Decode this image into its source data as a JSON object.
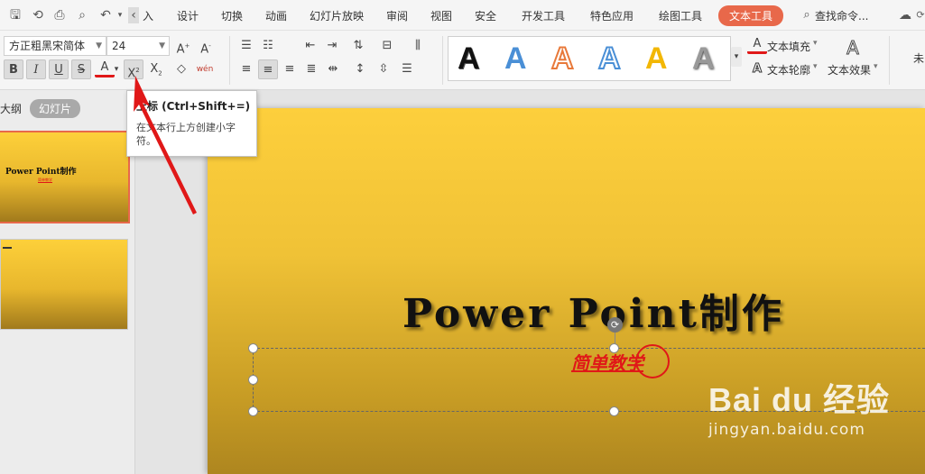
{
  "menubar": {
    "items": [
      "入",
      "设计",
      "切换",
      "动画",
      "幻灯片放映",
      "审阅",
      "视图",
      "安全",
      "开发工具",
      "特色应用",
      "绘图工具",
      "文本工具"
    ],
    "active_index": 11,
    "search_label": "查找命令..."
  },
  "ribbon": {
    "font_name": "方正粗黑宋简体",
    "font_size": "24",
    "wordart_samples": [
      "A",
      "A",
      "A",
      "A",
      "A",
      "A"
    ],
    "text_fill_label": "文本填充",
    "text_outline_label": "文本轮廓",
    "text_effect_label": "文本效果",
    "more_label": "未"
  },
  "left_pane": {
    "tab_outline": "大纲",
    "tab_slides": "幻灯片",
    "thumb1_title": "Power Point制作",
    "thumb1_sub": "简单教学"
  },
  "slide": {
    "title": "Power Point制作",
    "subtitle": "简单教学"
  },
  "tooltip": {
    "title": "上标 (Ctrl+Shift+=)",
    "description": "在文本行上方创建小字符。"
  },
  "watermark": {
    "brand": "Bai du 经验",
    "url": "jingyan.baidu.com"
  },
  "colors": {
    "accent": "#e8684a",
    "annotation_red": "#e01818",
    "slide_gold": "#fdcf3c"
  }
}
